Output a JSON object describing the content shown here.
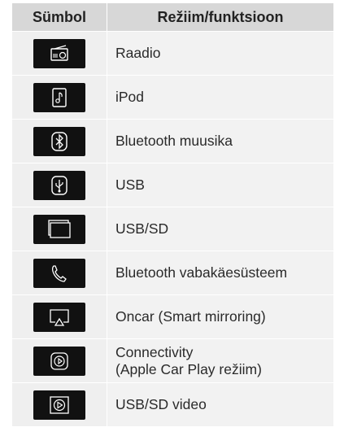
{
  "header": {
    "symbol": "Sümbol",
    "mode": "Režiim/funktsioon"
  },
  "rows": [
    {
      "icon": "radio-icon",
      "label": "Raadio"
    },
    {
      "icon": "ipod-icon",
      "label": "iPod"
    },
    {
      "icon": "bluetooth-icon",
      "label": "Bluetooth muusika"
    },
    {
      "icon": "usb-icon",
      "label": "USB"
    },
    {
      "icon": "usb-sd-icon",
      "label": "USB/SD"
    },
    {
      "icon": "phone-icon",
      "label": "Bluetooth vabakäesüsteem"
    },
    {
      "icon": "screen-mirror-icon",
      "label": "Oncar (Smart mirroring)"
    },
    {
      "icon": "carplay-icon",
      "label": "Connectivity",
      "label2": "(Apple Car Play režiim)"
    },
    {
      "icon": "video-play-icon",
      "label": "USB/SD video"
    }
  ]
}
